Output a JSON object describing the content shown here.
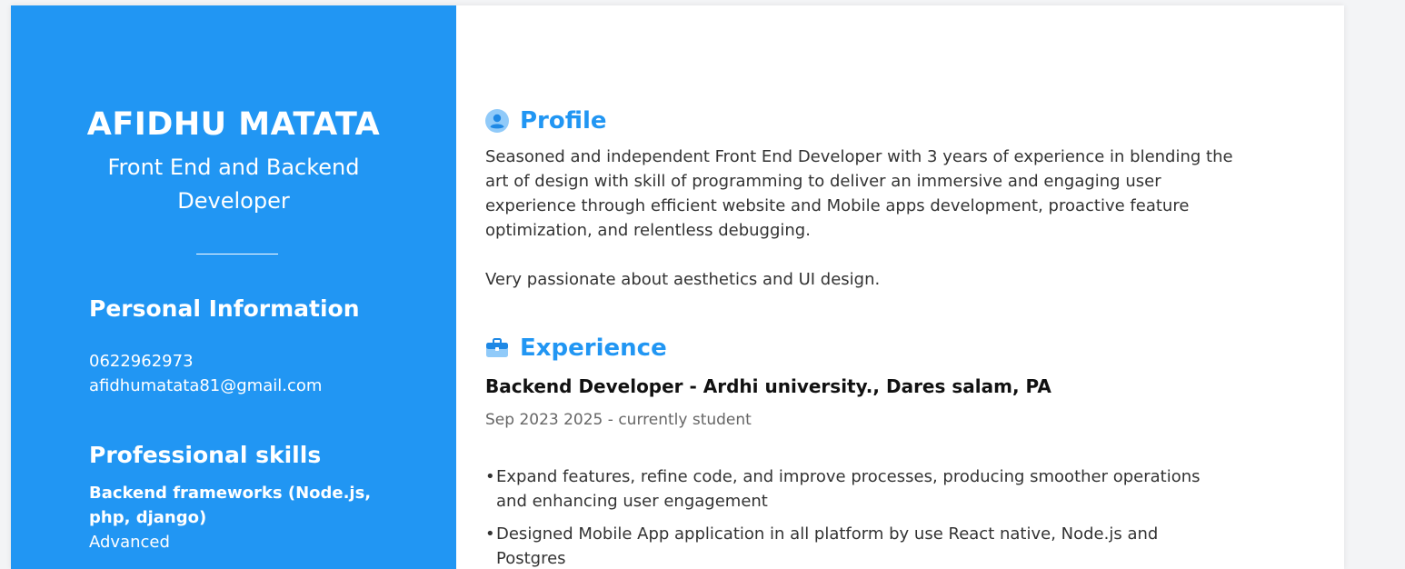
{
  "sidebar": {
    "name": "AFIDHU MATATA",
    "role": "Front End and Backend Developer",
    "personal_heading": "Personal Information",
    "phone": "0622962973",
    "email": "afidhumatata81@gmail.com",
    "skills_heading": "Professional skills",
    "skills": [
      {
        "name": "Backend frameworks (Node.js, php, django)",
        "level": "Advanced"
      }
    ]
  },
  "profile": {
    "heading": "Profile",
    "icon": "user-circle-icon",
    "paragraph1": "Seasoned and independent Front End Developer with 3 years of experience in blending the art of design with skill of programming to deliver an immersive and engaging user experience through efficient website and Mobile apps development, proactive feature optimization, and relentless debugging.",
    "paragraph2": "Very passionate about aesthetics and UI design."
  },
  "experience": {
    "heading": "Experience",
    "icon": "briefcase-icon",
    "jobs": [
      {
        "title": "Backend Developer - Ardhi university., Dares salam, PA",
        "dates": "Sep 2023 2025 - currently student",
        "bullets": [
          "Expand features, refine code, and improve processes, producing smoother operations and enhancing user engagement",
          "Designed Mobile App application in all platform by use React native, Node.js and Postgres"
        ]
      }
    ]
  },
  "colors": {
    "accent": "#2196f3",
    "text": "#333333",
    "muted": "#666666"
  }
}
